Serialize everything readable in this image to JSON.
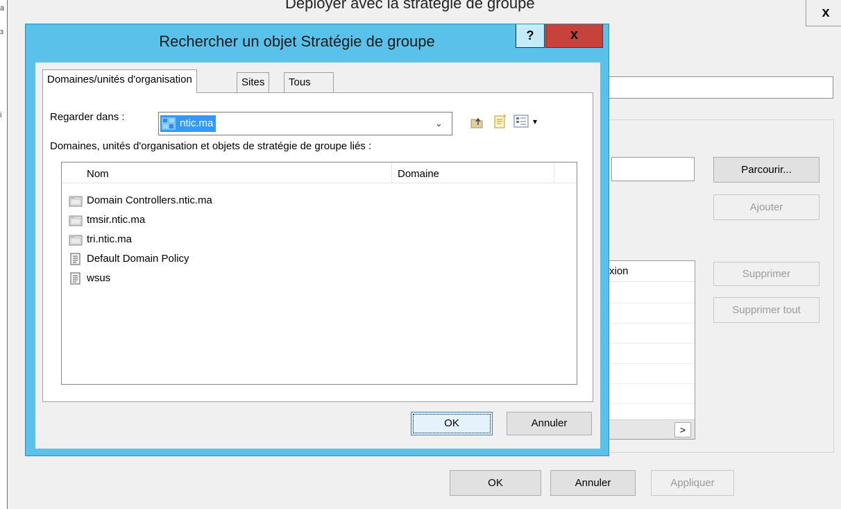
{
  "parent_window": {
    "title": "Déployer avec la stratégie de groupe",
    "close_label": "x",
    "buttons": {
      "parcourir": "Parcourir...",
      "ajouter": "Ajouter",
      "supprimer": "Supprimer",
      "supprimer_tout": "Supprimer tout",
      "ok": "OK",
      "annuler": "Annuler",
      "appliquer": "Appliquer"
    },
    "list_header_partial": "xion",
    "scroll_arrow": ">",
    "edge_glyphs": [
      "a",
      "ɜ",
      "i"
    ]
  },
  "dialog": {
    "title": "Rechercher un objet Stratégie de groupe",
    "help_label": "?",
    "close_label": "x",
    "tabs": [
      {
        "label": "Domaines/unités d'organisation",
        "active": true
      },
      {
        "label": "Sites",
        "active": false
      },
      {
        "label": "Tous",
        "active": false
      }
    ],
    "look_in": {
      "label": "Regarder dans :",
      "value": "ntic.ma",
      "arrow": "⌄"
    },
    "toolbar": {
      "view_arrow": "▾"
    },
    "list_caption": "Domaines, unités d'organisation et objets de stratégie de groupe liés :",
    "columns": [
      "Nom",
      "Domaine"
    ],
    "rows": [
      {
        "name": "Domain Controllers.ntic.ma",
        "icon": "ou-folder-icon"
      },
      {
        "name": "tmsir.ntic.ma",
        "icon": "ou-folder-icon"
      },
      {
        "name": "tri.ntic.ma",
        "icon": "ou-folder-icon"
      },
      {
        "name": "Default Domain Policy",
        "icon": "gpo-scroll-icon"
      },
      {
        "name": "wsus",
        "icon": "gpo-scroll-icon"
      }
    ],
    "buttons": {
      "ok": "OK",
      "annuler": "Annuler"
    }
  },
  "colors": {
    "dialog_frame": "#5ac2ea",
    "close_button": "#c6423a",
    "selection": "#3399ff"
  }
}
